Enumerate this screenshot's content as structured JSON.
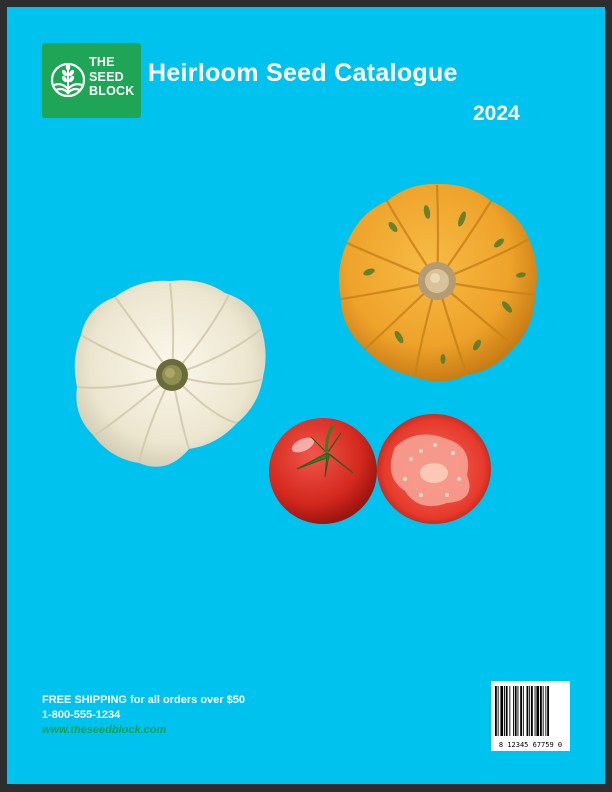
{
  "brand": {
    "name_lines": [
      "THE",
      "SEED",
      "BLOCK"
    ],
    "logo_color": "#1fa556",
    "icon": "wheat-sprout-icon"
  },
  "catalogue": {
    "title": "Heirloom Seed Catalogue",
    "year": "2024"
  },
  "background_color": "#00c2ef",
  "produce": [
    {
      "name": "white-pumpkin-image",
      "label": "white pumpkin"
    },
    {
      "name": "orange-pumpkin-image",
      "label": "orange speckled pumpkin"
    },
    {
      "name": "whole-tomato-image",
      "label": "whole tomato"
    },
    {
      "name": "sliced-tomato-image",
      "label": "sliced tomato"
    }
  ],
  "footer": {
    "shipping_bold": "FREE SHIPPING",
    "shipping_rest": " for all orders over $50",
    "phone": "1-800-555-1234",
    "website": "www.theseedblock.com"
  },
  "barcode": {
    "digits": "8 12345 67759 0"
  }
}
